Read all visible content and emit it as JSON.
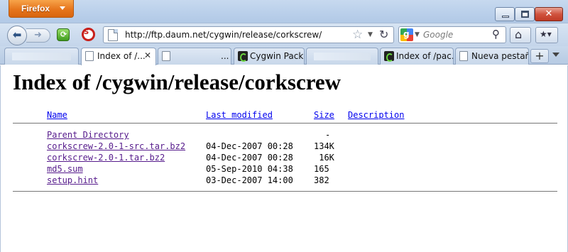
{
  "window": {
    "app_menu_label": "Firefox",
    "close_glyph": "✕"
  },
  "toolbar": {
    "url": "http://ftp.daum.net/cygwin/release/corkscrew/",
    "search_placeholder": "Google",
    "icons": [
      "back-icon",
      "forward-icon",
      "green-addon-icon",
      "red-addon-icon",
      "bookmark-star-icon",
      "reload-icon",
      "google-icon",
      "search-icon",
      "home-icon",
      "tools-icon"
    ]
  },
  "tabs": [
    {
      "label": "",
      "blank": true
    },
    {
      "label": "Index of /...",
      "active": true,
      "close": "✕"
    },
    {
      "label": "...",
      "blank": true
    },
    {
      "label": "Cygwin Pack...",
      "favicon": "cygwin"
    },
    {
      "label": "",
      "blank": true
    },
    {
      "label": "Index of /pac...",
      "favicon": "cygwin"
    },
    {
      "label": "Nueva pestaña",
      "favicon": "page"
    }
  ],
  "newtab_label": "+",
  "page": {
    "title": "Index of /cygwin/release/corkscrew",
    "columns": {
      "name": "Name",
      "last_modified": "Last modified",
      "size": "Size",
      "description": "Description"
    },
    "parent": {
      "name": "Parent Directory",
      "size": "-"
    },
    "files": [
      {
        "name": "corkscrew-2.0-1-src.tar.bz2",
        "date": "04-Dec-2007 00:28",
        "size": "134K"
      },
      {
        "name": "corkscrew-2.0-1.tar.bz2",
        "date": "04-Dec-2007 00:28",
        "size": " 16K"
      },
      {
        "name": "md5.sum",
        "date": "05-Sep-2010 04:38",
        "size": "165"
      },
      {
        "name": "setup.hint",
        "date": "03-Dec-2007 14:00",
        "size": "382"
      }
    ]
  },
  "colors": {
    "visited_link": "#551a8b",
    "unvisited_link": "#0000ee",
    "menu_orange": "#e6751c"
  }
}
